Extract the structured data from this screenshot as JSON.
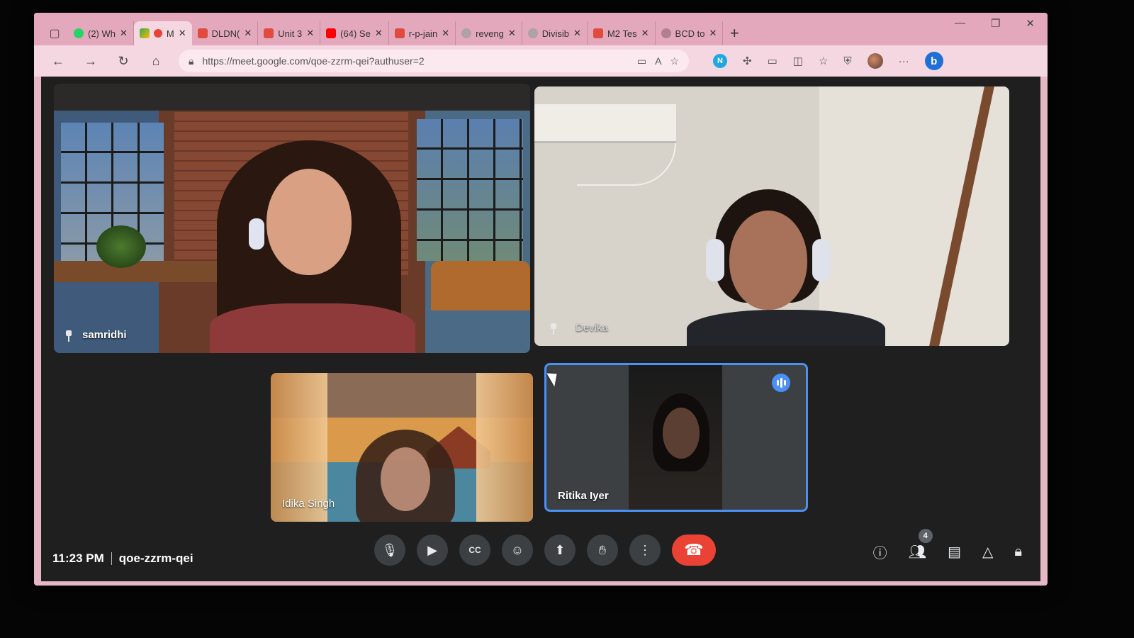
{
  "browser": {
    "tabs": [
      {
        "title": "(2) Wh",
        "favicon_color": "#25d366"
      },
      {
        "title": "M",
        "favicon_color": "#34a853",
        "active": true
      },
      {
        "title": "DLDN(",
        "favicon_color": "#e04a3f"
      },
      {
        "title": "Unit 3",
        "favicon_color": "#e04a3f"
      },
      {
        "title": "(64) Se",
        "favicon_color": "#ff0000"
      },
      {
        "title": "r-p-jain",
        "favicon_color": "#e04a3f"
      },
      {
        "title": "reveng",
        "favicon_color": "#b0a0a8"
      },
      {
        "title": "Divisib",
        "favicon_color": "#b0a0a8"
      },
      {
        "title": "M2 Tes",
        "favicon_color": "#e04a3f"
      },
      {
        "title": "BCD to",
        "favicon_color": "#b08090"
      }
    ],
    "url": "https://meet.google.com/qoe-zzrm-qei?authuser=2",
    "colors": {
      "chrome_pink": "#e4a8bd",
      "meet_bg": "#1f1f20",
      "speaking_blue": "#4a90f5",
      "end_call_red": "#ea4335"
    }
  },
  "meet": {
    "participants": [
      {
        "name": "samridhi",
        "pinned": true
      },
      {
        "name": "Devika",
        "pinned": true
      },
      {
        "name": "Idika Singh",
        "pinned": false
      },
      {
        "name": "Ritika Iyer",
        "pinned": false,
        "speaking": true
      }
    ],
    "time": "11:23 PM",
    "meeting_code": "qoe-zzrm-qei",
    "participant_count": "4",
    "controls": [
      "microphone-icon",
      "camera-icon",
      "captions-icon",
      "emoji-icon",
      "present-icon",
      "raise-hand-icon",
      "more-options-icon",
      "end-call-icon"
    ],
    "side_controls": [
      "info-icon",
      "people-icon",
      "chat-icon",
      "activities-icon",
      "host-controls-icon"
    ]
  }
}
